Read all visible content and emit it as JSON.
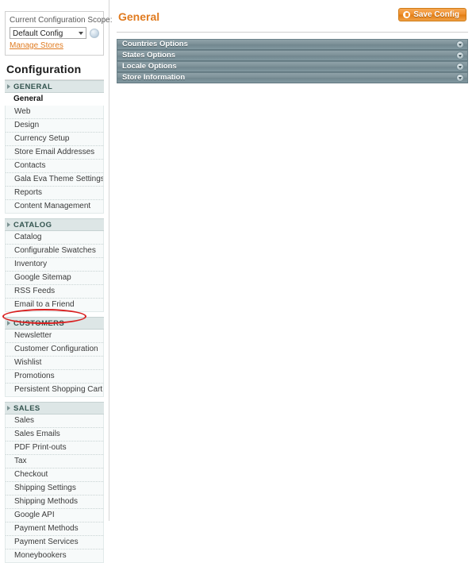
{
  "scope": {
    "label": "Current Configuration Scope:",
    "selected": "Default Config",
    "options": [
      "Default Config"
    ],
    "manage_stores_link": "Manage Stores",
    "help_icon": "help-icon"
  },
  "sidebar": {
    "title": "Configuration",
    "groups": [
      {
        "name": "GENERAL",
        "items": [
          {
            "label": "General",
            "current": true
          },
          {
            "label": "Web",
            "current": false
          },
          {
            "label": "Design",
            "current": false
          },
          {
            "label": "Currency Setup",
            "current": false
          },
          {
            "label": "Store Email Addresses",
            "current": false
          },
          {
            "label": "Contacts",
            "current": false
          },
          {
            "label": "Gala Eva Theme Settings",
            "current": false
          },
          {
            "label": "Reports",
            "current": false
          },
          {
            "label": "Content Management",
            "current": false
          }
        ]
      },
      {
        "name": "CATALOG",
        "items": [
          {
            "label": "Catalog",
            "current": false
          },
          {
            "label": "Configurable Swatches",
            "current": false
          },
          {
            "label": "Inventory",
            "current": false
          },
          {
            "label": "Google Sitemap",
            "current": false
          },
          {
            "label": "RSS Feeds",
            "current": false
          },
          {
            "label": "Email to a Friend",
            "current": false
          }
        ]
      },
      {
        "name": "CUSTOMERS",
        "items": [
          {
            "label": "Newsletter",
            "current": false
          },
          {
            "label": "Customer Configuration",
            "current": false
          },
          {
            "label": "Wishlist",
            "current": false
          },
          {
            "label": "Promotions",
            "current": false
          },
          {
            "label": "Persistent Shopping Cart",
            "current": false
          }
        ]
      },
      {
        "name": "SALES",
        "items": [
          {
            "label": "Sales",
            "current": false
          },
          {
            "label": "Sales Emails",
            "current": false
          },
          {
            "label": "PDF Print-outs",
            "current": false
          },
          {
            "label": "Tax",
            "current": false
          },
          {
            "label": "Checkout",
            "current": false
          },
          {
            "label": "Shipping Settings",
            "current": false
          },
          {
            "label": "Shipping Methods",
            "current": false
          },
          {
            "label": "Google API",
            "current": false
          },
          {
            "label": "Payment Methods",
            "current": false
          },
          {
            "label": "Payment Services",
            "current": false
          },
          {
            "label": "Moneybookers",
            "current": false
          }
        ]
      }
    ]
  },
  "main": {
    "page_title": "General",
    "save_button": {
      "label": "Save Config",
      "icon": "save-disk-icon"
    },
    "sections": [
      {
        "label": "Countries Options",
        "toggle_icon": "chevron-down-icon"
      },
      {
        "label": "States Options",
        "toggle_icon": "chevron-down-icon"
      },
      {
        "label": "Locale Options",
        "toggle_icon": "chevron-down-icon"
      },
      {
        "label": "Store Information",
        "toggle_icon": "chevron-down-icon"
      }
    ]
  },
  "annotation": {
    "shape": "ellipse",
    "color": "#d91f1f",
    "targets": "Customer Configuration"
  },
  "colors": {
    "accent_orange": "#e07b20",
    "section_bar": "#7d9198",
    "group_header": "#dde6e6",
    "annotation_red": "#d91f1f"
  }
}
